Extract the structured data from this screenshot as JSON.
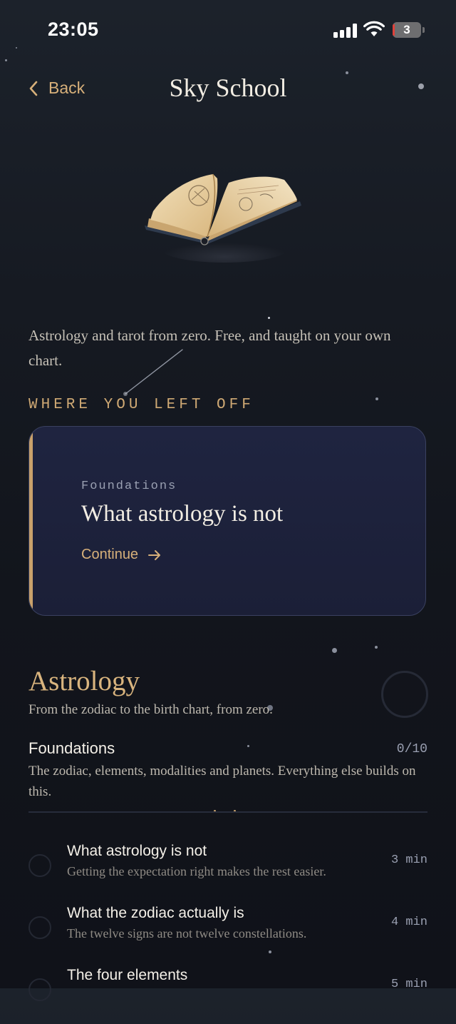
{
  "status_bar": {
    "time": "23:05",
    "battery": "3"
  },
  "nav": {
    "back_label": "Back",
    "title": "Sky School"
  },
  "intro": "Astrology and tarot from zero. Free, and taught on your own chart.",
  "resume": {
    "section_label": "WHERE YOU LEFT OFF",
    "kicker": "Foundations",
    "title": "What astrology is not",
    "cta": "Continue"
  },
  "course": {
    "title": "Astrology",
    "subtitle": "From the zodiac to the birth chart, from zero."
  },
  "module": {
    "title": "Foundations",
    "progress": "0/10",
    "description": "The zodiac, elements, modalities and planets. Everything else builds on this."
  },
  "lessons": [
    {
      "title": "What astrology is not",
      "subtitle": "Getting the expectation right makes the rest easier.",
      "duration": "3 min"
    },
    {
      "title": "What the zodiac actually is",
      "subtitle": "The twelve signs are not twelve constellations.",
      "duration": "4 min"
    },
    {
      "title": "The four elements",
      "subtitle": "",
      "duration": "5 min"
    }
  ],
  "colors": {
    "accent": "#d7b07a",
    "background": "#12151c",
    "card": "#1e2340"
  }
}
